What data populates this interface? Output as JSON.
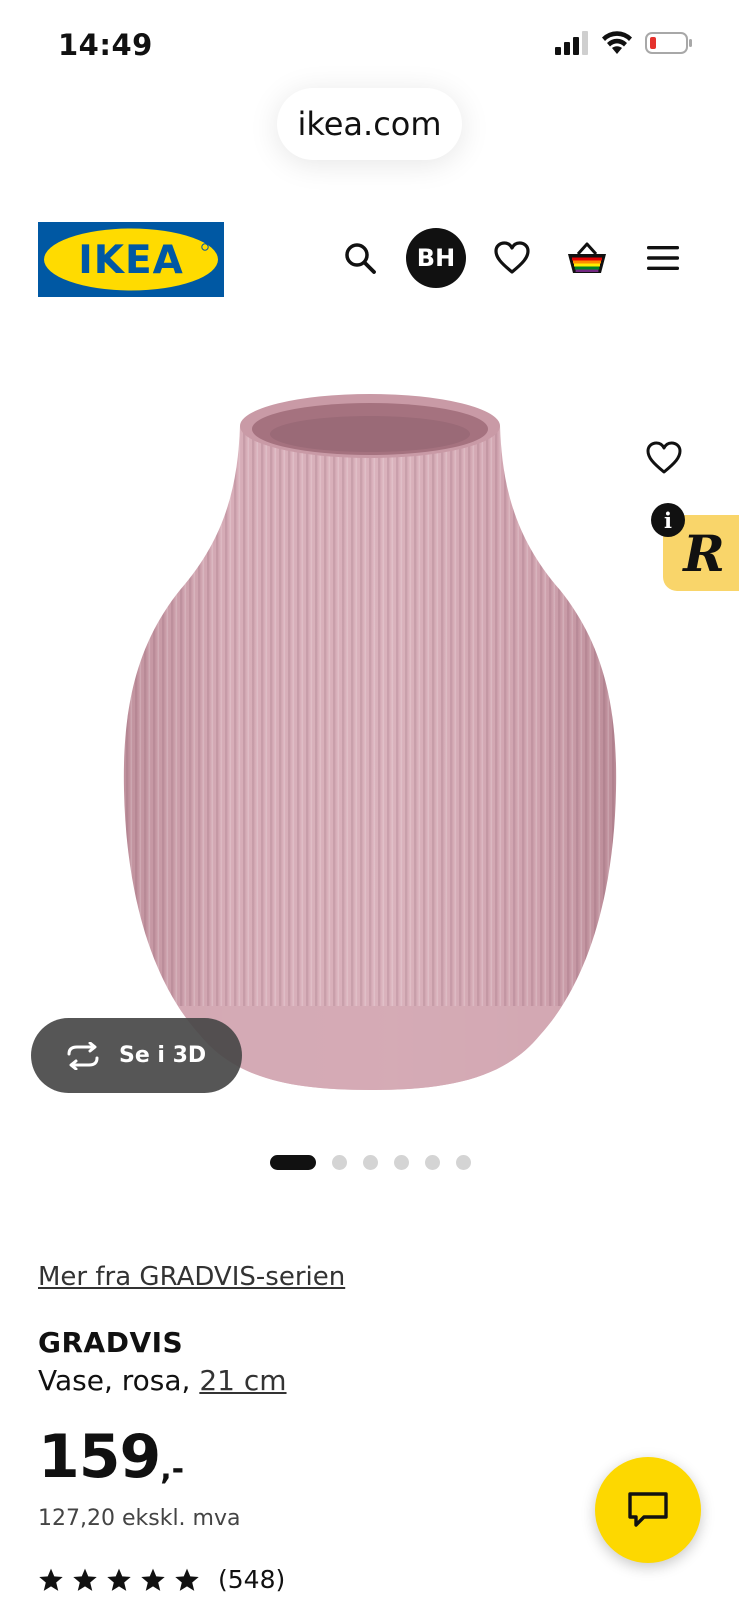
{
  "status_bar": {
    "time": "14:49"
  },
  "browser": {
    "url": "ikea.com"
  },
  "header": {
    "logo_text": "IKEA",
    "avatar_initials": "BH",
    "brand_colors": {
      "blue": "#0058a3",
      "yellow": "#ffdb00"
    },
    "icons": [
      "search-icon",
      "avatar",
      "heart-icon",
      "basket-icon",
      "menu-icon"
    ]
  },
  "gallery": {
    "view_3d_label": "Se i 3D",
    "image_count": 6,
    "active_index": 0,
    "vase_color": "#d3a7b2"
  },
  "product": {
    "series_link": "Mer fra GRADVIS-serien",
    "name": "GRADVIS",
    "description_prefix": "Vase, rosa, ",
    "size": "21 cm",
    "price_main": "159",
    "price_suffix": ",-",
    "price_ex_vat": "127,20 ekskl. mva",
    "rating_stars": 5,
    "review_count": "(548)"
  },
  "chat": {
    "button_color": "#fdd800",
    "icon": "chat-icon"
  }
}
